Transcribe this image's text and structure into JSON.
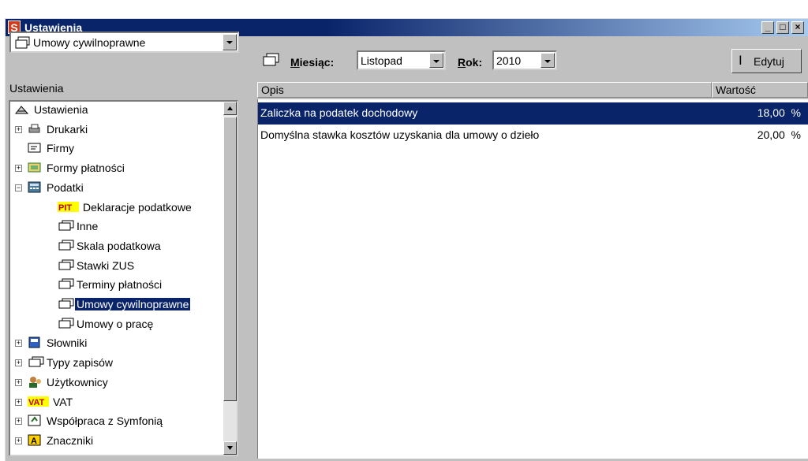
{
  "window": {
    "title": "Ustawienia",
    "app_icon_letter": "S",
    "minimize": "_",
    "maximize": "□",
    "close": "×"
  },
  "left": {
    "combo_value": "Umowy cywilnoprawne",
    "header": "Ustawienia",
    "tree": [
      {
        "label": "Ustawienia",
        "icon": "settings-root-icon",
        "level": 0,
        "expander": ""
      },
      {
        "label": "Drukarki",
        "icon": "printer-icon",
        "level": 1,
        "expander": "+"
      },
      {
        "label": "Firmy",
        "icon": "company-card-icon",
        "level": 1,
        "expander": ""
      },
      {
        "label": "Formy płatności",
        "icon": "payment-forms-icon",
        "level": 1,
        "expander": "+"
      },
      {
        "label": "Podatki",
        "icon": "calculator-icon",
        "level": 1,
        "expander": "−"
      },
      {
        "label": "Deklaracje podatkowe",
        "icon": "pit-icon",
        "level": 2,
        "expander": ""
      },
      {
        "label": "Inne",
        "icon": "folder-tab-icon",
        "level": 2,
        "expander": ""
      },
      {
        "label": "Skala podatkowa",
        "icon": "folder-tab-icon",
        "level": 2,
        "expander": ""
      },
      {
        "label": "Stawki ZUS",
        "icon": "folder-tab-icon",
        "level": 2,
        "expander": ""
      },
      {
        "label": "Terminy płatności",
        "icon": "folder-tab-icon",
        "level": 2,
        "expander": ""
      },
      {
        "label": "Umowy cywilnoprawne",
        "icon": "folder-tab-icon",
        "level": 2,
        "expander": "",
        "selected": true
      },
      {
        "label": "Umowy o pracę",
        "icon": "folder-tab-icon",
        "level": 2,
        "expander": ""
      },
      {
        "label": "Słowniki",
        "icon": "dictionary-icon",
        "level": 1,
        "expander": "+"
      },
      {
        "label": "Typy zapisów",
        "icon": "folder-tab-icon",
        "level": 1,
        "expander": "+"
      },
      {
        "label": "Użytkownicy",
        "icon": "users-icon",
        "level": 1,
        "expander": "+"
      },
      {
        "label": "VAT",
        "icon": "vat-icon",
        "level": 1,
        "expander": "+"
      },
      {
        "label": "Współpraca z Symfonią",
        "icon": "integration-icon",
        "level": 1,
        "expander": "+"
      },
      {
        "label": "Znaczniki",
        "icon": "marker-icon",
        "level": 1,
        "expander": "+"
      }
    ]
  },
  "right": {
    "month_label": "Miesiąc:",
    "month_value": "Listopad",
    "year_label": "Rok:",
    "year_value": "2010",
    "edit_label": "Edytuj",
    "col_opis": "Opis",
    "col_wartosc": "Wartość",
    "rows": [
      {
        "opis": "Zaliczka na podatek dochodowy",
        "value": "18,00",
        "unit": "%",
        "selected": true
      },
      {
        "opis": "Domyślna stawka kosztów uzyskania dla umowy o dzieło",
        "value": "20,00",
        "unit": "%",
        "selected": false
      }
    ]
  },
  "colors": {
    "titlebar": "#0a246a",
    "selection": "#0a246a",
    "face": "#c0c0c0"
  }
}
